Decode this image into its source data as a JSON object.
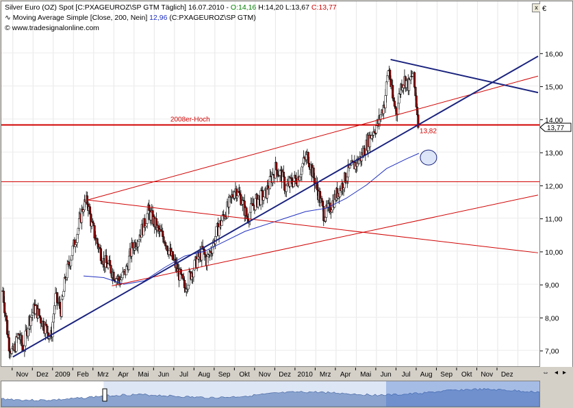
{
  "header": {
    "line1_a": "Silver Euro (OZ) Spot [C:PXAGEUROZ\\SP GTM  Täglich] 16.07.2010 -",
    "line1_o": "O:14,16",
    "line1_h": "H:14,20",
    "line1_l": "L:13,67",
    "line1_c": "C:13,77",
    "line2_a": "Moving Average Simple [Close, 200, Nein]",
    "line2_v": "12,96",
    "line2_b": "(C:PXAGEUROZ\\SP GTM)",
    "line3": "www.tradesignalonline.com",
    "close_label": "x"
  },
  "colors": {
    "candle_up": "#ffffff",
    "candle_down": "#8b0000",
    "ma_line": "#1f2fbf",
    "trend_blue": "#1a237e",
    "trend_red": "#d00000",
    "price_tag": "#d00000"
  },
  "annotations": {
    "hoch_label": "2008er-Hoch",
    "level_label": "13,82",
    "last_price_tag": "13,77"
  },
  "chart_data": {
    "type": "candlestick",
    "title": "Silver Euro (OZ) Spot",
    "currency_label": "€",
    "ylim": [
      6.6,
      16.4
    ],
    "y_ticks": [
      "16,00",
      "15,00",
      "14,00",
      "13,00",
      "12,00",
      "11,00",
      "10,00",
      "9,00",
      "8,00",
      "7,00"
    ],
    "y_tick_values": [
      16,
      15,
      14,
      13,
      12,
      11,
      10,
      9,
      8,
      7
    ],
    "x_tick_labels": [
      "Nov",
      "Dez",
      "2009",
      "Feb",
      "Mrz",
      "Apr",
      "Mai",
      "Jun",
      "Jul",
      "Aug",
      "Sep",
      "Okt",
      "Nov",
      "Dez",
      "2010",
      "Mrz",
      "Apr",
      "Mai",
      "Jun",
      "Jul",
      "Aug",
      "Sep",
      "Okt",
      "Nov",
      "Dez"
    ],
    "x_range_months": [
      0,
      26.5
    ],
    "months_with_prices_up_to": 20.6,
    "price_path": [
      [
        0.0,
        8.8
      ],
      [
        0.3,
        7.2
      ],
      [
        0.5,
        6.9
      ],
      [
        0.8,
        7.5
      ],
      [
        1.0,
        7.0
      ],
      [
        1.3,
        7.9
      ],
      [
        1.6,
        8.3
      ],
      [
        2.0,
        7.8
      ],
      [
        2.4,
        7.4
      ],
      [
        2.6,
        8.6
      ],
      [
        2.9,
        8.2
      ],
      [
        3.1,
        9.2
      ],
      [
        3.4,
        9.9
      ],
      [
        3.7,
        10.6
      ],
      [
        4.0,
        11.4
      ],
      [
        4.2,
        11.5
      ],
      [
        4.4,
        10.8
      ],
      [
        4.7,
        10.2
      ],
      [
        5.0,
        9.7
      ],
      [
        5.3,
        9.5
      ],
      [
        5.5,
        9.3
      ],
      [
        5.8,
        9.1
      ],
      [
        6.1,
        9.4
      ],
      [
        6.4,
        10.1
      ],
      [
        6.7,
        10.4
      ],
      [
        7.0,
        10.8
      ],
      [
        7.2,
        11.2
      ],
      [
        7.4,
        11.0
      ],
      [
        7.7,
        10.6
      ],
      [
        8.0,
        10.4
      ],
      [
        8.3,
        9.9
      ],
      [
        8.6,
        9.5
      ],
      [
        8.8,
        9.2
      ],
      [
        9.0,
        8.9
      ],
      [
        9.3,
        9.3
      ],
      [
        9.6,
        9.7
      ],
      [
        9.9,
        10.0
      ],
      [
        10.1,
        9.7
      ],
      [
        10.4,
        10.2
      ],
      [
        10.6,
        10.6
      ],
      [
        10.9,
        11.0
      ],
      [
        11.2,
        11.4
      ],
      [
        11.5,
        11.9
      ],
      [
        11.8,
        11.6
      ],
      [
        12.1,
        11.0
      ],
      [
        12.4,
        11.4
      ],
      [
        12.7,
        11.6
      ],
      [
        13.0,
        11.7
      ],
      [
        13.3,
        12.2
      ],
      [
        13.5,
        12.5
      ],
      [
        13.8,
        12.3
      ],
      [
        14.0,
        11.9
      ],
      [
        14.3,
        12.1
      ],
      [
        14.6,
        12.2
      ],
      [
        14.9,
        12.7
      ],
      [
        15.1,
        12.9
      ],
      [
        15.4,
        12.2
      ],
      [
        15.7,
        11.6
      ],
      [
        15.9,
        11.1
      ],
      [
        16.2,
        11.3
      ],
      [
        16.5,
        11.7
      ],
      [
        16.8,
        12.0
      ],
      [
        17.1,
        12.4
      ],
      [
        17.4,
        12.6
      ],
      [
        17.7,
        12.8
      ],
      [
        18.0,
        13.2
      ],
      [
        18.3,
        13.6
      ],
      [
        18.6,
        13.9
      ],
      [
        18.9,
        14.5
      ],
      [
        19.1,
        15.6
      ],
      [
        19.3,
        14.6
      ],
      [
        19.5,
        14.2
      ],
      [
        19.7,
        15.0
      ],
      [
        19.9,
        15.2
      ],
      [
        20.1,
        15.0
      ],
      [
        20.3,
        15.4
      ],
      [
        20.45,
        14.6
      ],
      [
        20.6,
        13.77
      ]
    ],
    "ma_path": [
      [
        4.0,
        9.25
      ],
      [
        5.0,
        9.2
      ],
      [
        6.0,
        9.0
      ],
      [
        7.0,
        9.1
      ],
      [
        8.0,
        9.5
      ],
      [
        9.0,
        9.85
      ],
      [
        10.0,
        10.0
      ],
      [
        11.0,
        10.3
      ],
      [
        12.0,
        10.6
      ],
      [
        13.0,
        10.8
      ],
      [
        14.0,
        11.0
      ],
      [
        15.0,
        11.2
      ],
      [
        16.0,
        11.3
      ],
      [
        17.0,
        11.6
      ],
      [
        18.0,
        12.0
      ],
      [
        19.0,
        12.5
      ],
      [
        20.0,
        12.8
      ],
      [
        20.6,
        12.96
      ]
    ],
    "ma_value_last": 12.96,
    "horizontal_levels": [
      13.82,
      12.1
    ],
    "trendlines_blue": [
      {
        "from": [
          0.5,
          6.8
        ],
        "to": [
          26.5,
          15.9
        ]
      },
      {
        "from": [
          19.2,
          15.8
        ],
        "to": [
          26.5,
          14.8
        ]
      }
    ],
    "trendlines_red": [
      {
        "from": [
          4.2,
          11.55
        ],
        "to": [
          26.5,
          15.3
        ]
      },
      {
        "from": [
          4.2,
          11.55
        ],
        "to": [
          26.5,
          9.95
        ]
      },
      {
        "from": [
          5.4,
          8.95
        ],
        "to": [
          26.5,
          11.7
        ]
      }
    ],
    "circle_marker": {
      "x": 20.6,
      "y": 13.0
    }
  },
  "overview": {
    "highlight_start": 0.19,
    "highlight_end": 1.0
  }
}
